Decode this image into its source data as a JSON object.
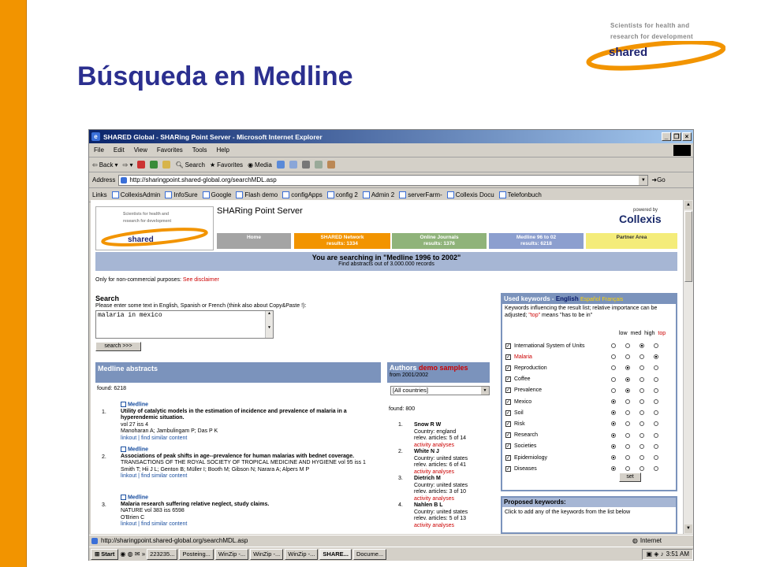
{
  "slide": {
    "title": "Búsqueda en Medline",
    "logo_tagline_1": "Scientists for health and",
    "logo_tagline_2": "research for development",
    "logo_brand": "shared"
  },
  "window": {
    "title": "SHARED Global - SHARing Point Server - Microsoft Internet Explorer",
    "menu": [
      "File",
      "Edit",
      "View",
      "Favorites",
      "Tools",
      "Help"
    ],
    "toolbar": {
      "back": "Back",
      "search": "Search",
      "favorites": "Favorites",
      "media": "Media"
    },
    "address_label": "Address",
    "address_url": "http://sharingpoint.shared-global.org/searchMDL.asp",
    "go_label": "Go",
    "links_label": "Links",
    "links": [
      "CollexisAdmin",
      "InfoSure",
      "Google",
      "Flash demo",
      "configApps",
      "config 2",
      "Admin 2",
      "serverFarm-",
      "Collexis Docu",
      "Telefonbuch"
    ]
  },
  "page": {
    "site_title": "SHARing Point Server",
    "powered_by": "powered by",
    "collexis": "Collexis",
    "nav": [
      {
        "label": "Home",
        "sub": "",
        "color": "#a4a4a4"
      },
      {
        "label": "SHARED Network",
        "sub": "results: 1334",
        "color": "#f29400"
      },
      {
        "label": "Online Journals",
        "sub": "results: 1376",
        "color": "#8fb37a"
      },
      {
        "label": "Medline 96 to 02",
        "sub": "results: 6218",
        "color": "#8c9fcf"
      },
      {
        "label": "Partner Area",
        "sub": "",
        "color": "#f4ec7a"
      }
    ],
    "banner_main": "You are searching in \"Medline 1996 to 2002\"",
    "banner_sub": "Find abstracts out of 3.000.000 records",
    "noncommercial": "Only for non-commercial purposes:",
    "disclaimer": "See disclaimer",
    "search_heading": "Search",
    "search_hint": "Please enter some text in English, Spanish or French (think also about Copy&Paste !):",
    "search_value": "malaria in mexico",
    "search_button": "search >>>",
    "medline_heading": "Medline abstracts",
    "found_medline": "found: 6218",
    "citations": [
      {
        "n": "1.",
        "src": "Medline",
        "title": "Utility of catalytic models in the estimation of incidence and prevalence of malaria in a hyperendemic situation.",
        "journal": "vol 27 iss 4",
        "authors": "Manoharan A; Jambulingam P; Das P K",
        "links": "linkout | find similar content"
      },
      {
        "n": "2.",
        "src": "Medline",
        "title": "Associations of peak shifts in age--prevalence for human malarias with bednet coverage.",
        "journal": "TRANSACTIONS OF THE ROYAL SOCIETY OF TROPICAL MEDICINE AND HYGIENE vol 95 iss 1",
        "authors": "Smith T; Hii J L; Genton B; Müller I; Booth M; Gibson N; Narara A; Alpers M P",
        "links": "linkout | find similar content"
      },
      {
        "n": "3.",
        "src": "Medline",
        "title": "Malaria research suffering relative neglect, study claims.",
        "journal": "NATURE vol 383 iss 6598",
        "authors": "O'Brien C",
        "links": "linkout | find similar content"
      }
    ],
    "authors_heading": "Authors",
    "authors_demo": "demo samples",
    "authors_from": "from 2001/2002",
    "country_select": "[All countries]",
    "found_authors": "found: 800",
    "authors": [
      {
        "n": "1.",
        "name": "Snow R W",
        "country": "Country: england",
        "rel": "relev. articles: 5 of 14",
        "act": "activity analyses"
      },
      {
        "n": "2.",
        "name": "White N J",
        "country": "Country: united states",
        "rel": "relev. articles: 6 of 41",
        "act": "activity analyses"
      },
      {
        "n": "3.",
        "name": "Dietrich M",
        "country": "Country: united states",
        "rel": "relev. articles: 3 of 10",
        "act": "activity analyses"
      },
      {
        "n": "4.",
        "name": "Nahlen B L",
        "country": "Country: united states",
        "rel": "relev. articles: 5 of 13",
        "act": "activity analyses"
      }
    ],
    "kw_heading": "Used keywords -",
    "kw_lang_en": "English",
    "kw_lang_es": "Español",
    "kw_lang_fr": "Français",
    "kw_hint_a": "Keywords influencing the result list; relative importance can be adjusted;",
    "kw_hint_top": "\"top\"",
    "kw_hint_b": "means \"has to be in\"",
    "kw_cols": [
      "low",
      "med",
      "high",
      "top"
    ],
    "keywords": [
      {
        "label": "International System of Units",
        "sel": 2,
        "red": false
      },
      {
        "label": "Malaria",
        "sel": 3,
        "red": true
      },
      {
        "label": "Reproduction",
        "sel": 1,
        "red": false
      },
      {
        "label": "Coffee",
        "sel": 1,
        "red": false
      },
      {
        "label": "Prevalence",
        "sel": 1,
        "red": false
      },
      {
        "label": "Mexico",
        "sel": 0,
        "red": false
      },
      {
        "label": "Soil",
        "sel": 0,
        "red": false
      },
      {
        "label": "Risk",
        "sel": 0,
        "red": false
      },
      {
        "label": "Research",
        "sel": 0,
        "red": false
      },
      {
        "label": "Societies",
        "sel": 0,
        "red": false
      },
      {
        "label": "Epidemiology",
        "sel": 0,
        "red": false
      },
      {
        "label": "Diseases",
        "sel": 0,
        "red": false
      }
    ],
    "set_button": "set",
    "proposed_heading": "Proposed keywords:",
    "proposed_hint": "Click to add any of the keywords from the list below"
  },
  "status": {
    "url": "http://sharingpoint.shared-global.org/searchMDL.asp",
    "zone": "Internet"
  },
  "taskbar": {
    "start": "Start",
    "items": [
      "223235...",
      "Posteing...",
      "WinZip -...",
      "WinZip -...",
      "WinZip -...",
      "SHARE...",
      "Docume..."
    ],
    "clock": "3:51 AM"
  }
}
